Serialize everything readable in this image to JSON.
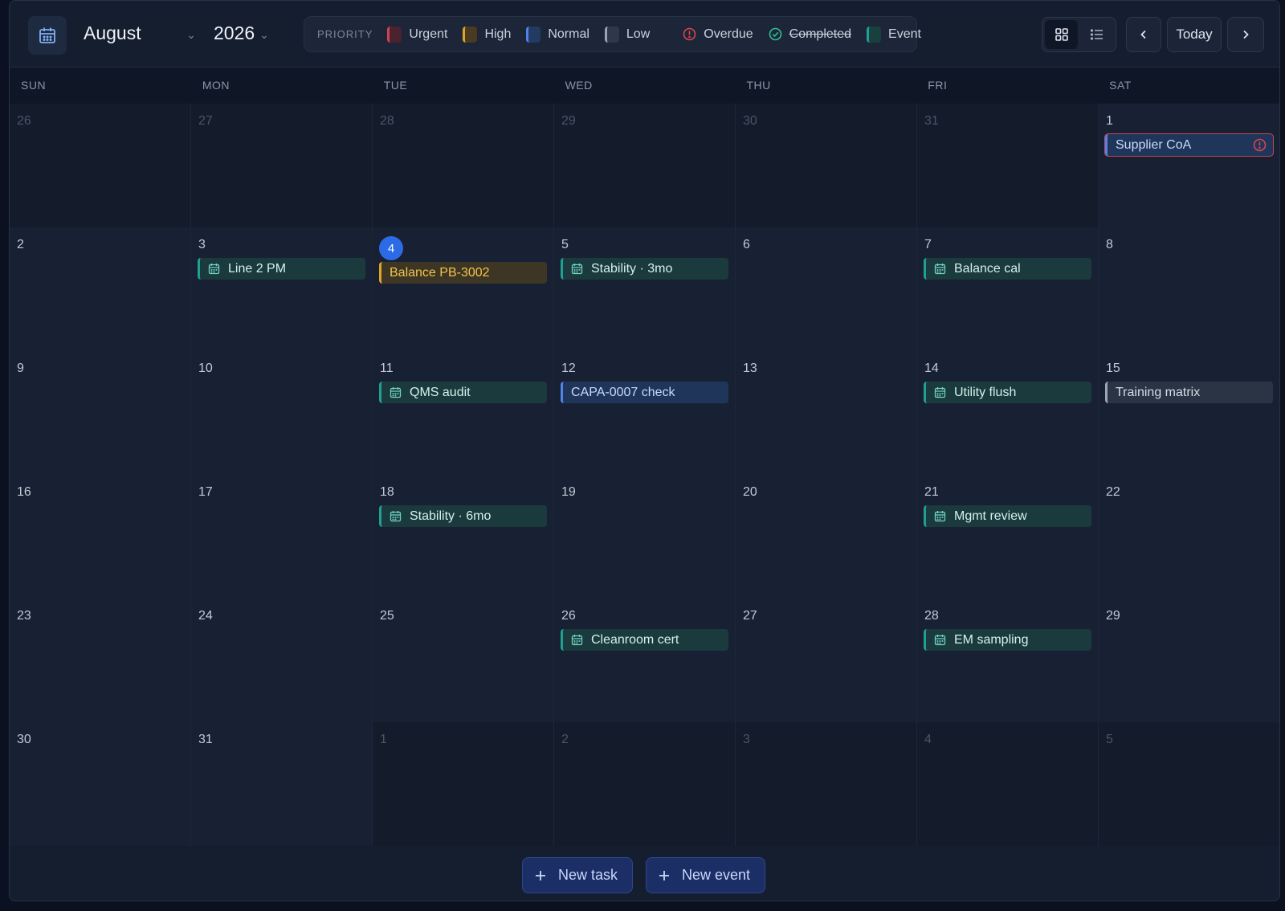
{
  "header": {
    "month": "August",
    "year": "2026"
  },
  "legend": {
    "label": "PRIORITY",
    "items": [
      {
        "name": "Urgent",
        "color": "#d04452"
      },
      {
        "name": "High",
        "color": "#e0a428"
      },
      {
        "name": "Normal",
        "color": "#4f84e8"
      },
      {
        "name": "Low",
        "color": "#9aa5b6"
      }
    ],
    "overdue": "Overdue",
    "completed": "Completed",
    "event": "Event"
  },
  "nav": {
    "today": "Today"
  },
  "weekdays": [
    "SUN",
    "MON",
    "TUE",
    "WED",
    "THU",
    "FRI",
    "SAT"
  ],
  "days": [
    [
      "26",
      "27",
      "28",
      "29",
      "30",
      "31",
      "1"
    ],
    [
      "2",
      "3",
      "4",
      "5",
      "6",
      "7",
      "8"
    ],
    [
      "9",
      "10",
      "11",
      "12",
      "13",
      "14",
      "15"
    ],
    [
      "16",
      "17",
      "18",
      "19",
      "20",
      "21",
      "22"
    ],
    [
      "23",
      "24",
      "25",
      "26",
      "27",
      "28",
      "29"
    ],
    [
      "30",
      "31",
      "1",
      "2",
      "3",
      "4",
      "5"
    ]
  ],
  "events": {
    "supplier_coa": "Supplier CoA",
    "line2pm": "Line 2 PM",
    "balance_pb": "Balance PB-3002",
    "stability3": "Stability · 3mo",
    "balance_cal": "Balance cal",
    "qms_audit": "QMS audit",
    "capa_check": "CAPA-0007 check",
    "utility_flush": "Utility flush",
    "training_matrix": "Training matrix",
    "stability6": "Stability · 6mo",
    "mgmt_review": "Mgmt review",
    "cleanroom": "Cleanroom cert",
    "em_sampling": "EM sampling"
  },
  "footer": {
    "new_task": "New task",
    "new_event": "New event"
  }
}
